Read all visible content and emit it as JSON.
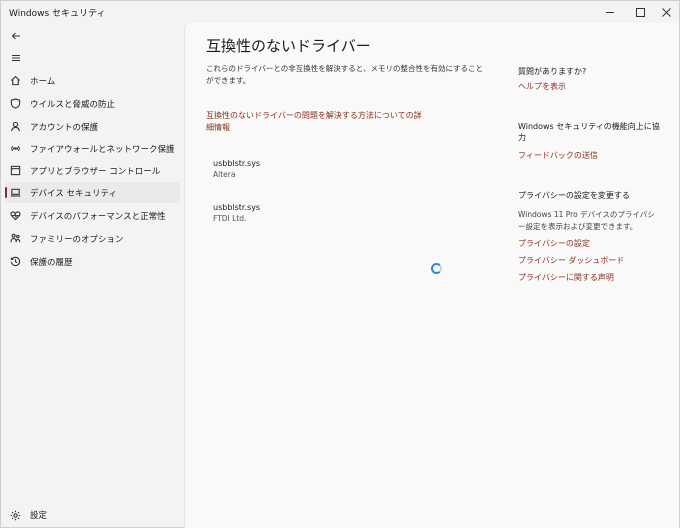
{
  "window": {
    "title": "Windows セキュリティ"
  },
  "sidebar": {
    "items": [
      {
        "label": "ホーム",
        "icon": "home-icon"
      },
      {
        "label": "ウイルスと脅威の防止",
        "icon": "shield-icon"
      },
      {
        "label": "アカウントの保護",
        "icon": "person-icon"
      },
      {
        "label": "ファイアウォールとネットワーク保護",
        "icon": "wifi-icon"
      },
      {
        "label": "アプリとブラウザー コントロール",
        "icon": "app-window-icon"
      },
      {
        "label": "デバイス セキュリティ",
        "icon": "laptop-icon",
        "selected": true
      },
      {
        "label": "デバイスのパフォーマンスと正常性",
        "icon": "heart-icon"
      },
      {
        "label": "ファミリーのオプション",
        "icon": "family-icon"
      },
      {
        "label": "保護の履歴",
        "icon": "history-icon"
      }
    ],
    "settings_label": "設定"
  },
  "main": {
    "title": "互換性のないドライバー",
    "description": "これらのドライバーとの非互換性を解決すると、メモリの整合性を有効にすることができます。",
    "details_link": "互換性のないドライバーの問題を解決する方法についての詳細情報",
    "drivers": [
      {
        "name": "usbblstr.sys",
        "vendor": "Altera"
      },
      {
        "name": "usbblstr.sys",
        "vendor": "FTDI Ltd."
      }
    ]
  },
  "right_panel": {
    "help_heading": "質問がありますか?",
    "help_link": "ヘルプを表示",
    "improve_heading": "Windows セキュリティの機能向上に協力",
    "feedback_link": "フィードバックの送信",
    "privacy_heading": "プライバシーの設定を変更する",
    "privacy_text": "Windows 11 Pro デバイスのプライバシー設定を表示および変更できます。",
    "privacy_settings_link": "プライバシーの設定",
    "privacy_dashboard_link": "プライバシー ダッシュボード",
    "privacy_statement_link": "プライバシーに関する声明"
  },
  "colors": {
    "accent_link": "#8a2f1f",
    "spinner": "#2b88d8"
  }
}
